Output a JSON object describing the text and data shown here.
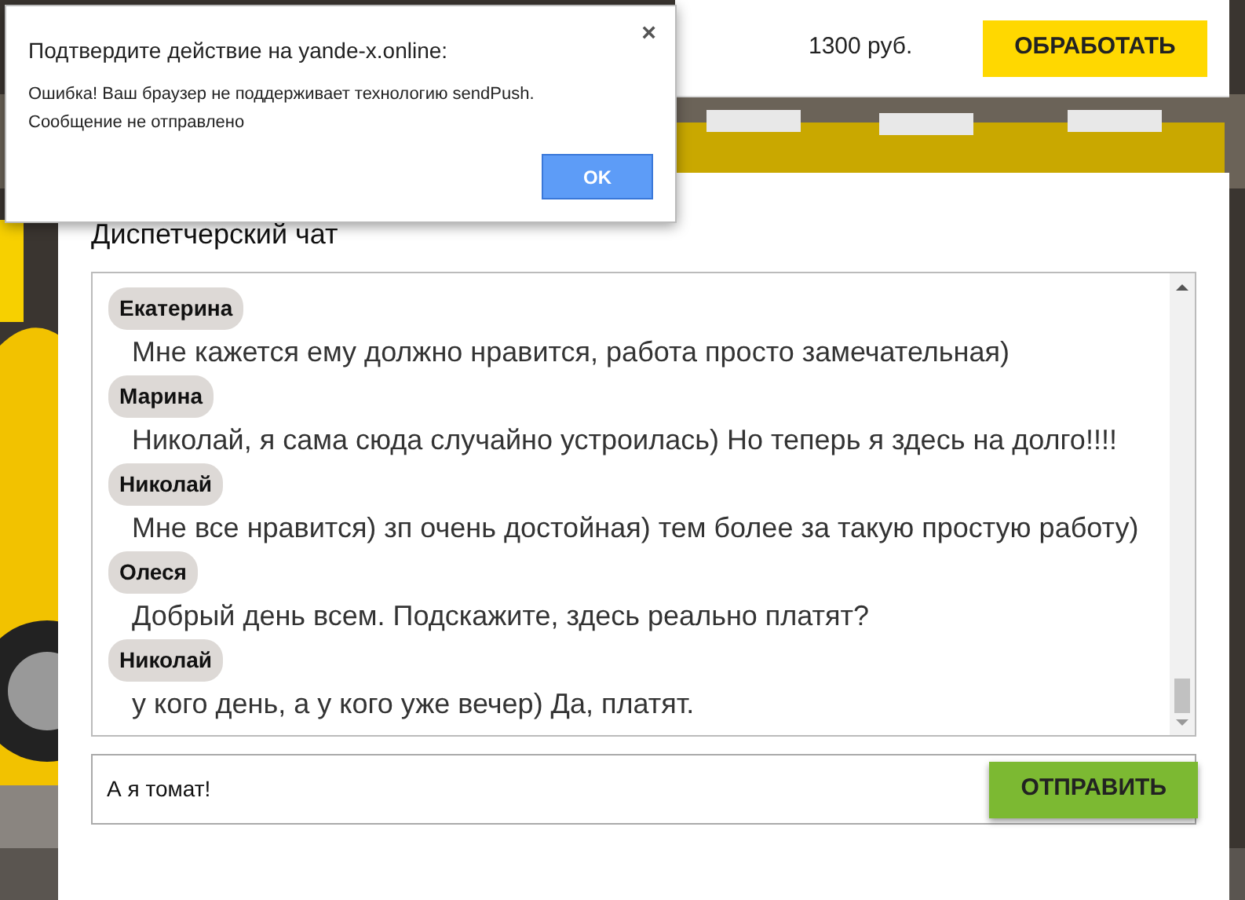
{
  "order_bar": {
    "price": "1300 руб.",
    "button": "ОБРАБОТАТЬ"
  },
  "chat": {
    "title": "Диспетчерский чат",
    "messages": [
      {
        "author": "Екатерина",
        "text": "Мне кажется ему должно нравится, работа просто замечательная)"
      },
      {
        "author": "Марина",
        "text": "Николай, я сама сюда случайно устроилась) Но теперь я здесь на долго!!!!"
      },
      {
        "author": "Николай",
        "text": "Мне все нравится) зп очень достойная) тем более за такую простую работу)"
      },
      {
        "author": "Олеся",
        "text": "Добрый день всем. Подскажите, здесь реально платят?"
      },
      {
        "author": "Николай",
        "text": "у кого день, а у кого уже вечер) Да, платят."
      }
    ],
    "input": {
      "value": "А я томат!"
    },
    "send_button": "ОТПРАВИТЬ"
  },
  "dialog": {
    "title": "Подтвердите действие на yande-x.online:",
    "close": "×",
    "message": "Ошибка! Ваш браузер не поддерживает технологию sendPush.",
    "message_2": "Сообщение не отправлено",
    "ok": "OK"
  }
}
